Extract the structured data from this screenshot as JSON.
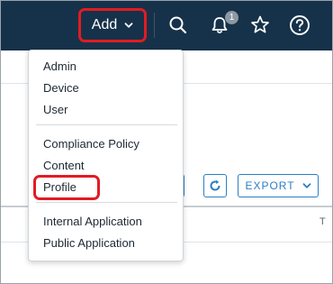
{
  "header": {
    "add_label": "Add",
    "notification_count": "1",
    "icons": [
      "chevron-down-icon",
      "search-icon",
      "bell-icon",
      "star-icon",
      "help-icon"
    ]
  },
  "dropdown": {
    "items": [
      "Admin",
      "Device",
      "User",
      "Compliance Policy",
      "Content",
      "Profile",
      "Internal Application",
      "Public Application"
    ]
  },
  "toolbar": {
    "export_label": "EXPORT",
    "column_header_cut": "T"
  },
  "colors": {
    "topbar": "#16324a",
    "highlight": "#e21b23",
    "accent": "#2a7fc4"
  }
}
